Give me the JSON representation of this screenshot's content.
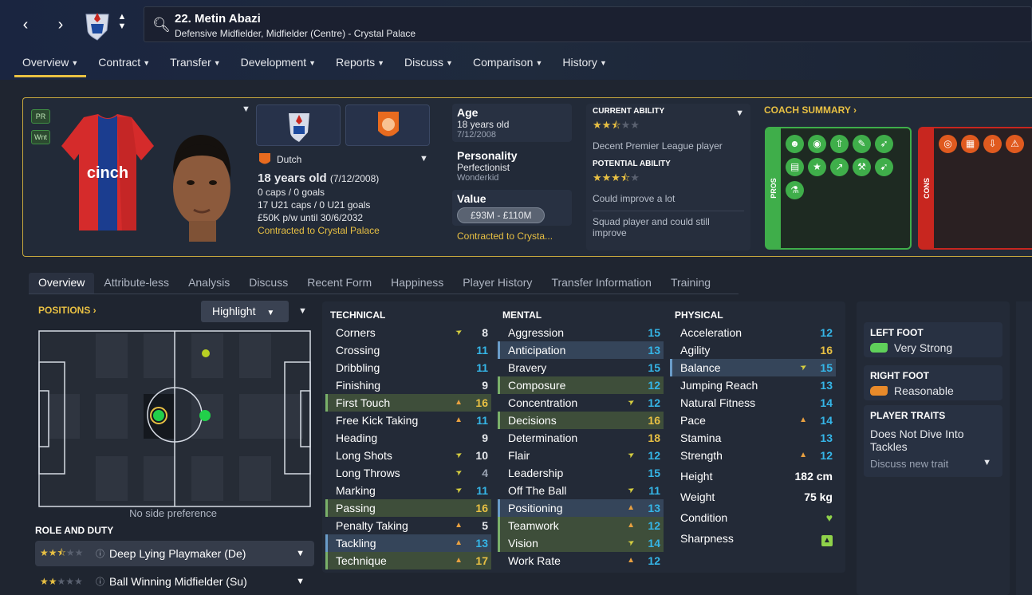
{
  "header": {
    "player_name": "22. Metin Abazi",
    "subtitle": "Defensive Midfielder, Midfielder (Centre) - Crystal Palace"
  },
  "main_nav": [
    "Overview",
    "Contract",
    "Transfer",
    "Development",
    "Reports",
    "Discuss",
    "Comparison",
    "History"
  ],
  "badges": [
    "PR",
    "Wnt"
  ],
  "info": {
    "nationality": "Dutch",
    "age_line": "18 years old",
    "dob_paren": "(7/12/2008)",
    "caps": "0 caps / 0 goals",
    "u21": "17 U21 caps / 0 U21 goals",
    "wage": "£50K p/w until 30/6/2032",
    "contract": "Contracted to Crystal Palace"
  },
  "summary": {
    "age_label": "Age",
    "age_value": "18 years old",
    "dob": "7/12/2008",
    "personality_label": "Personality",
    "personality_value": "Perfectionist",
    "personality_sub": "Wonderkid",
    "value_label": "Value",
    "value": "£93M - £110M",
    "contract_short": "Contracted to Crysta..."
  },
  "ability": {
    "ca_label": "CURRENT ABILITY",
    "ca_text": "Decent Premier League player",
    "pa_label": "POTENTIAL ABILITY",
    "pa_text": "Could improve a lot",
    "note": "Squad player and could still improve",
    "ca_stars": 2.5,
    "pa_stars": 3.5
  },
  "coach_summary": "COACH SUMMARY",
  "pros_label": "PROS",
  "cons_label": "CONS",
  "sub_tabs": [
    "Overview",
    "Attribute-less",
    "Analysis",
    "Discuss",
    "Recent Form",
    "Happiness",
    "Player History",
    "Transfer Information",
    "Training"
  ],
  "positions": {
    "header": "POSITIONS",
    "highlight": "Highlight",
    "no_side": "No side preference",
    "role_header": "ROLE AND DUTY",
    "roles": [
      {
        "name": "Deep Lying Playmaker (De)",
        "stars": 2.5
      },
      {
        "name": "Ball Winning Midfielder (Su)",
        "stars": 2
      }
    ]
  },
  "attributes": {
    "technical_header": "TECHNICAL",
    "mental_header": "MENTAL",
    "physical_header": "PHYSICAL",
    "technical": [
      {
        "name": "Corners",
        "value": "8",
        "arrow": "dn",
        "hl": ""
      },
      {
        "name": "Crossing",
        "value": "11",
        "arrow": "",
        "hl": ""
      },
      {
        "name": "Dribbling",
        "value": "11",
        "arrow": "",
        "hl": ""
      },
      {
        "name": "Finishing",
        "value": "9",
        "arrow": "",
        "hl": ""
      },
      {
        "name": "First Touch",
        "value": "16",
        "arrow": "up",
        "hl": "g"
      },
      {
        "name": "Free Kick Taking",
        "value": "11",
        "arrow": "up",
        "hl": ""
      },
      {
        "name": "Heading",
        "value": "9",
        "arrow": "",
        "hl": ""
      },
      {
        "name": "Long Shots",
        "value": "10",
        "arrow": "dn",
        "hl": ""
      },
      {
        "name": "Long Throws",
        "value": "4",
        "arrow": "dn",
        "hl": ""
      },
      {
        "name": "Marking",
        "value": "11",
        "arrow": "dn",
        "hl": ""
      },
      {
        "name": "Passing",
        "value": "16",
        "arrow": "",
        "hl": "g"
      },
      {
        "name": "Penalty Taking",
        "value": "5",
        "arrow": "up",
        "hl": ""
      },
      {
        "name": "Tackling",
        "value": "13",
        "arrow": "up",
        "hl": "b"
      },
      {
        "name": "Technique",
        "value": "17",
        "arrow": "up",
        "hl": "g"
      }
    ],
    "mental": [
      {
        "name": "Aggression",
        "value": "15",
        "arrow": "",
        "hl": ""
      },
      {
        "name": "Anticipation",
        "value": "13",
        "arrow": "",
        "hl": "b"
      },
      {
        "name": "Bravery",
        "value": "15",
        "arrow": "",
        "hl": ""
      },
      {
        "name": "Composure",
        "value": "12",
        "arrow": "",
        "hl": "g"
      },
      {
        "name": "Concentration",
        "value": "12",
        "arrow": "dn",
        "hl": ""
      },
      {
        "name": "Decisions",
        "value": "16",
        "arrow": "",
        "hl": "g"
      },
      {
        "name": "Determination",
        "value": "18",
        "arrow": "",
        "hl": ""
      },
      {
        "name": "Flair",
        "value": "12",
        "arrow": "dn",
        "hl": ""
      },
      {
        "name": "Leadership",
        "value": "15",
        "arrow": "",
        "hl": ""
      },
      {
        "name": "Off The Ball",
        "value": "11",
        "arrow": "dn",
        "hl": ""
      },
      {
        "name": "Positioning",
        "value": "13",
        "arrow": "up",
        "hl": "b"
      },
      {
        "name": "Teamwork",
        "value": "12",
        "arrow": "up",
        "hl": "g"
      },
      {
        "name": "Vision",
        "value": "14",
        "arrow": "dn",
        "hl": "g"
      },
      {
        "name": "Work Rate",
        "value": "12",
        "arrow": "up",
        "hl": ""
      }
    ],
    "physical": [
      {
        "name": "Acceleration",
        "value": "12",
        "arrow": "",
        "hl": ""
      },
      {
        "name": "Agility",
        "value": "16",
        "arrow": "",
        "hl": ""
      },
      {
        "name": "Balance",
        "value": "15",
        "arrow": "dn",
        "hl": "b"
      },
      {
        "name": "Jumping Reach",
        "value": "13",
        "arrow": "",
        "hl": ""
      },
      {
        "name": "Natural Fitness",
        "value": "14",
        "arrow": "",
        "hl": ""
      },
      {
        "name": "Pace",
        "value": "14",
        "arrow": "up",
        "hl": ""
      },
      {
        "name": "Stamina",
        "value": "13",
        "arrow": "",
        "hl": ""
      },
      {
        "name": "Strength",
        "value": "12",
        "arrow": "up",
        "hl": ""
      }
    ],
    "height_label": "Height",
    "height": "182 cm",
    "weight_label": "Weight",
    "weight": "75 kg",
    "condition_label": "Condition",
    "sharpness_label": "Sharpness"
  },
  "feet": {
    "left_label": "LEFT FOOT",
    "left_value": "Very Strong",
    "right_label": "RIGHT FOOT",
    "right_value": "Reasonable",
    "traits_label": "PLAYER TRAITS",
    "trait": "Does Not Dive Into Tackles",
    "discuss": "Discuss new trait"
  },
  "colors": {
    "accent": "#e8c043",
    "pros": "#3fae4a",
    "cons": "#c8261f",
    "blue_value": "#35b6e8"
  }
}
